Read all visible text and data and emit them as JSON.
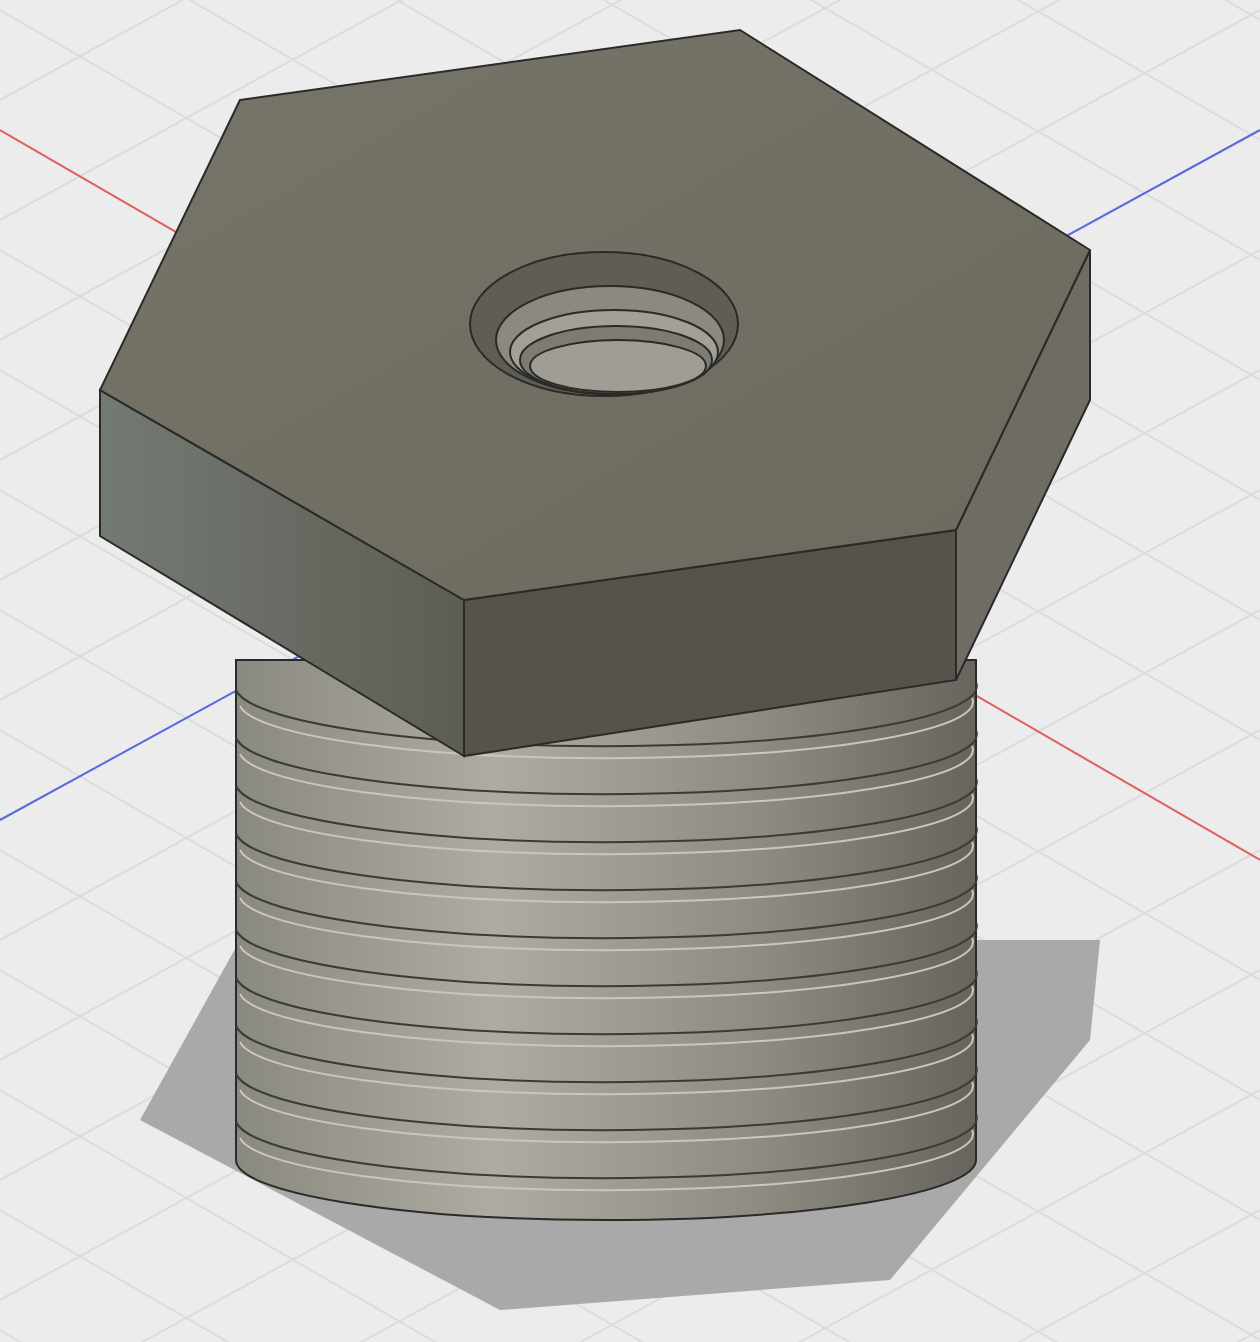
{
  "viewport": {
    "axes": [
      {
        "color": "#e06060"
      },
      {
        "color": "#5a6ae0"
      }
    ]
  }
}
